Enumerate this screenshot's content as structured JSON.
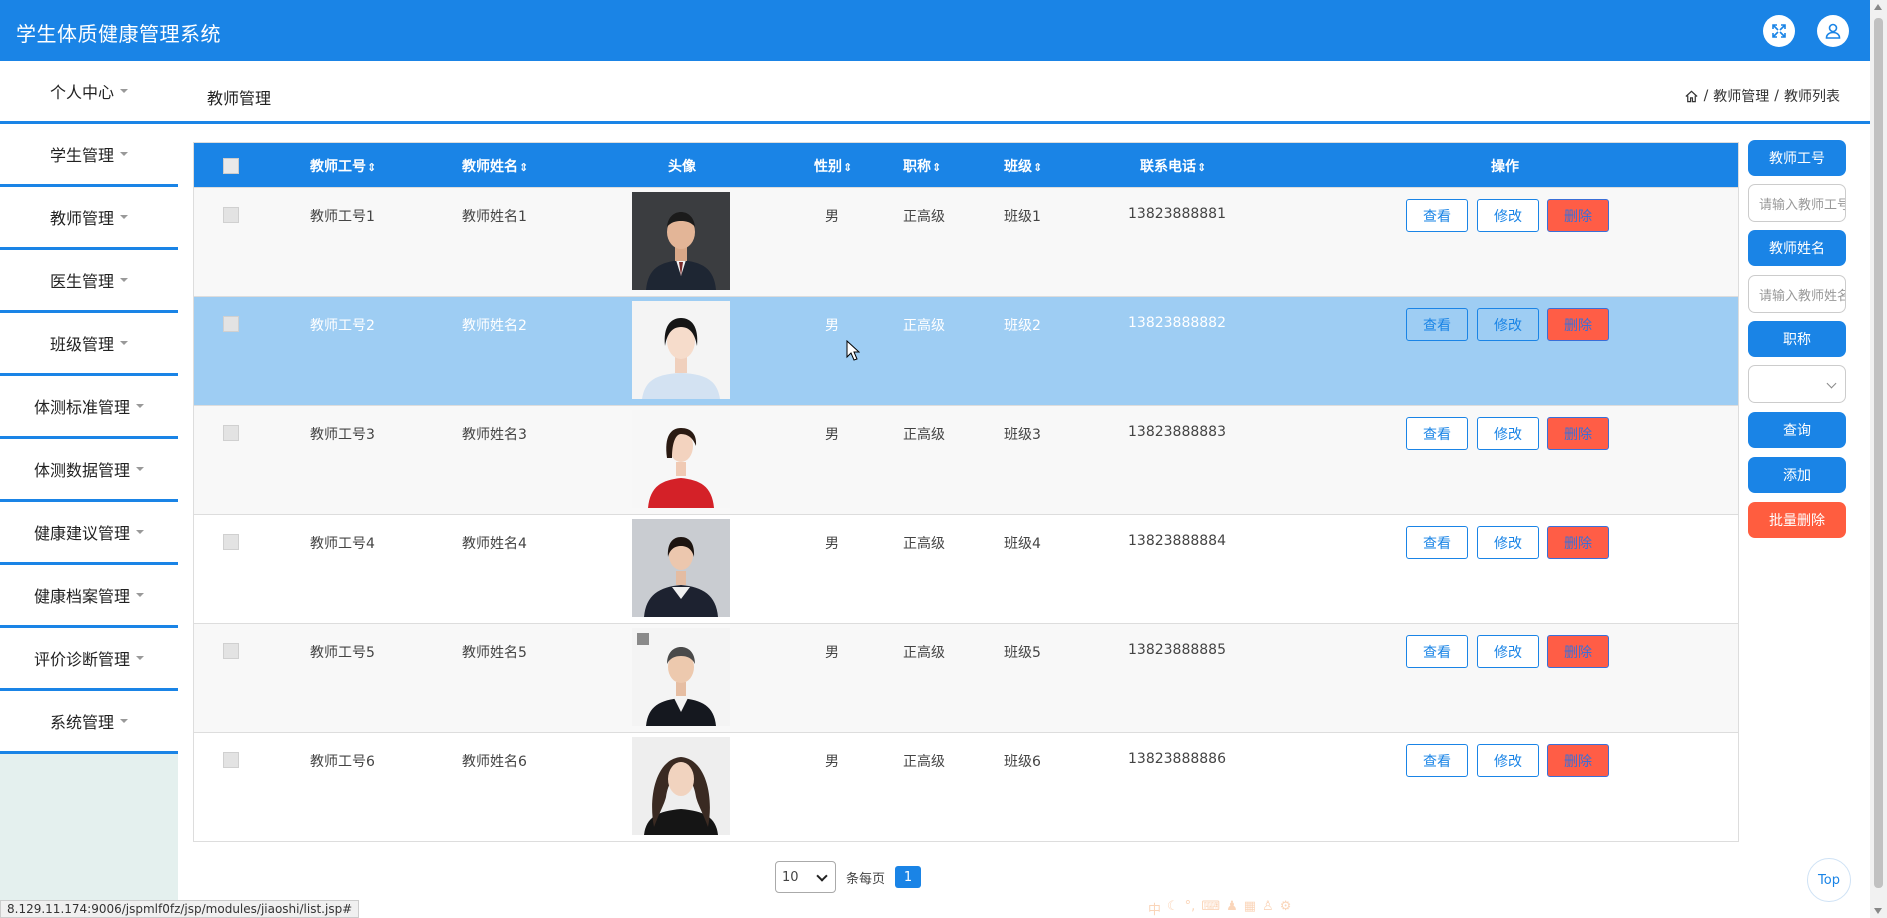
{
  "app": {
    "title": "学生体质健康管理系统"
  },
  "sidebar": {
    "items": [
      {
        "label": "个人中心"
      },
      {
        "label": "学生管理"
      },
      {
        "label": "教师管理"
      },
      {
        "label": "医生管理"
      },
      {
        "label": "班级管理"
      },
      {
        "label": "体测标准管理"
      },
      {
        "label": "体测数据管理"
      },
      {
        "label": "健康建议管理"
      },
      {
        "label": "健康档案管理"
      },
      {
        "label": "评价诊断管理"
      },
      {
        "label": "系统管理"
      }
    ]
  },
  "header": {
    "section_title": "教师管理",
    "breadcrumb": [
      "教师管理",
      "教师列表"
    ],
    "separator": "/"
  },
  "table": {
    "columns": {
      "id": "教师工号",
      "name": "教师姓名",
      "avatar": "头像",
      "gender": "性别",
      "title": "职称",
      "class": "班级",
      "phone": "联系电话",
      "ops": "操作"
    },
    "sort_icon": "⇕",
    "rows": [
      {
        "id": "教师工号1",
        "name": "教师姓名1",
        "gender": "男",
        "title": "正高级",
        "class": "班级1",
        "phone": "13823888881"
      },
      {
        "id": "教师工号2",
        "name": "教师姓名2",
        "gender": "男",
        "title": "正高级",
        "class": "班级2",
        "phone": "13823888882"
      },
      {
        "id": "教师工号3",
        "name": "教师姓名3",
        "gender": "男",
        "title": "正高级",
        "class": "班级3",
        "phone": "13823888883"
      },
      {
        "id": "教师工号4",
        "name": "教师姓名4",
        "gender": "男",
        "title": "正高级",
        "class": "班级4",
        "phone": "13823888884"
      },
      {
        "id": "教师工号5",
        "name": "教师姓名5",
        "gender": "男",
        "title": "正高级",
        "class": "班级5",
        "phone": "13823888885"
      },
      {
        "id": "教师工号6",
        "name": "教师姓名6",
        "gender": "男",
        "title": "正高级",
        "class": "班级6",
        "phone": "13823888886"
      }
    ],
    "actions": {
      "view": "查看",
      "edit": "修改",
      "delete": "删除"
    }
  },
  "search_panel": {
    "id_label": "教师工号",
    "id_placeholder": "请输入教师工号",
    "name_label": "教师姓名",
    "name_placeholder": "请输入教师姓名",
    "title_label": "职称",
    "title_value": "",
    "query_button": "查询",
    "add_button": "添加",
    "batch_delete_button": "批量删除"
  },
  "pagination": {
    "page_size": "10",
    "per_page_label": "条每页",
    "current_page": "1"
  },
  "status_bar": {
    "url": "8.129.11.174:9006/jspmlf0fz/jsp/modules/jiaoshi/list.jsp#"
  },
  "float": {
    "top_label": "Top"
  },
  "ime": {
    "label": "中"
  },
  "colors": {
    "primary": "#1a84e6",
    "danger": "#ff5d46",
    "selected_row": "#9ecdf3",
    "sidebar_bg": "#e4f0ee"
  }
}
